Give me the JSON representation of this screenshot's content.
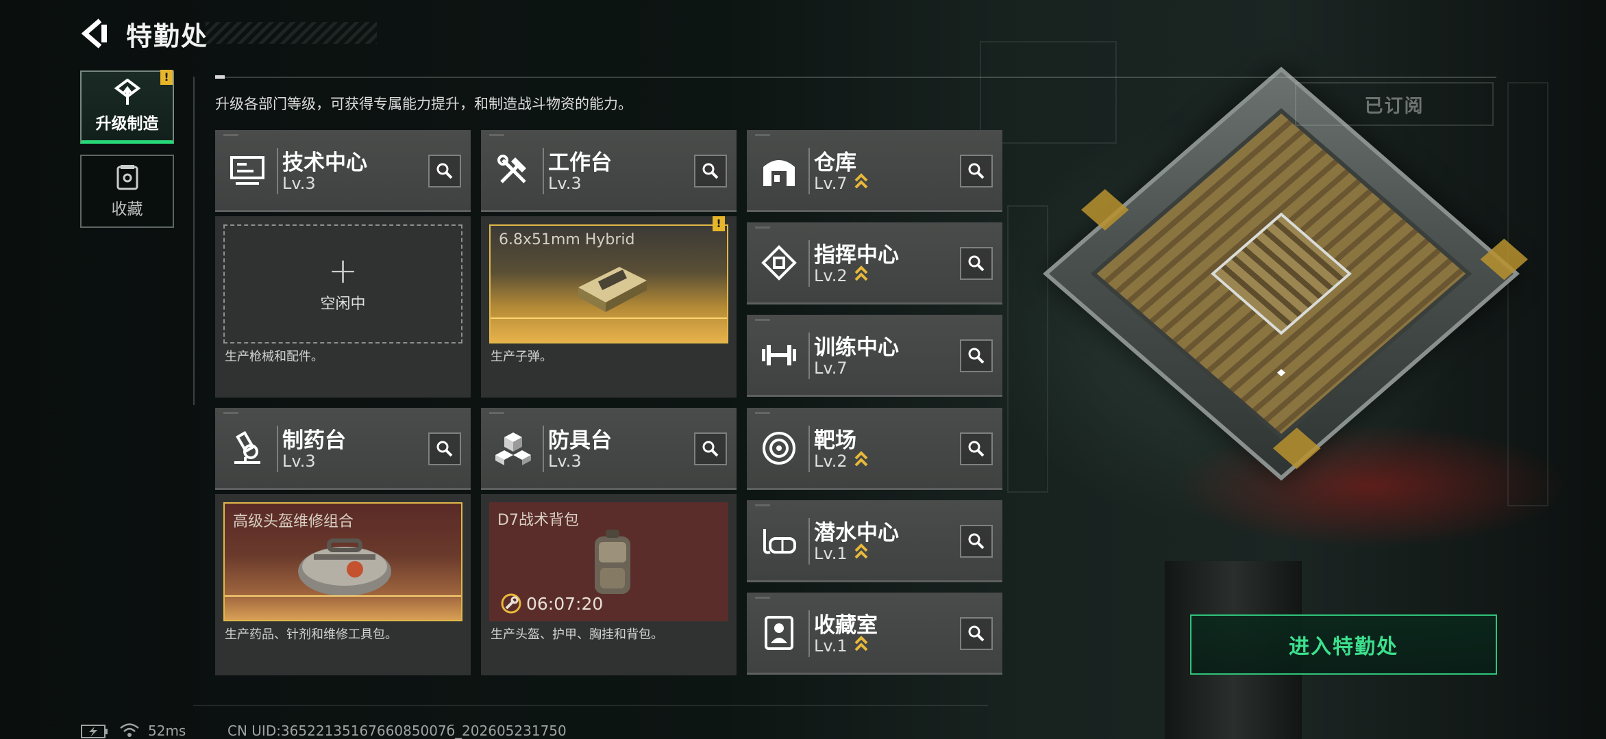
{
  "header": {
    "title": "特勤处"
  },
  "sidebar": {
    "items": [
      {
        "label": "升级制造",
        "active": true,
        "alert": "!"
      },
      {
        "label": "收藏",
        "active": false
      }
    ]
  },
  "subtitle": "升级各部门等级，可获得专属能力提升，和制造战斗物资的能力。",
  "subscribed_label": "已订阅",
  "workshops": [
    {
      "name": "技术中心",
      "level": "Lv.3",
      "icon": "monitor-icon",
      "slot": {
        "state": "idle",
        "plus": "+",
        "label": "空闲中"
      },
      "description": "生产枪械和配件。"
    },
    {
      "name": "工作台",
      "level": "Lv.3",
      "icon": "tools-icon",
      "slot": {
        "state": "producing",
        "item": "6.8x51mm Hybrid",
        "alert": "!"
      },
      "description": "生产子弹。"
    },
    {
      "name": "制药台",
      "level": "Lv.3",
      "icon": "microscope-icon",
      "slot": {
        "state": "producing",
        "item": "高级头盔维修组合"
      },
      "description": "生产药品、针剂和维修工具包。"
    },
    {
      "name": "防具台",
      "level": "Lv.3",
      "icon": "cubes-icon",
      "slot": {
        "state": "producing",
        "item": "D7战术背包",
        "timer": "06:07:20"
      },
      "description": "生产头盔、护甲、胸挂和背包。"
    }
  ],
  "facilities": [
    {
      "name": "仓库",
      "level": "Lv.7",
      "icon": "warehouse-icon",
      "upgradable": true
    },
    {
      "name": "指挥中心",
      "level": "Lv.2",
      "icon": "chip-icon",
      "upgradable": true
    },
    {
      "name": "训练中心",
      "level": "Lv.7",
      "icon": "dumbbell-icon",
      "upgradable": false
    },
    {
      "name": "靶场",
      "level": "Lv.2",
      "icon": "target-icon",
      "upgradable": true
    },
    {
      "name": "潜水中心",
      "level": "Lv.1",
      "icon": "diving-mask-icon",
      "upgradable": true
    },
    {
      "name": "收藏室",
      "level": "Lv.1",
      "icon": "bust-icon",
      "upgradable": true
    }
  ],
  "enter_button": "进入特勤处",
  "status_bar": {
    "ping": "52ms",
    "uid": "CN UID:3652213516766085007б_202605231750"
  },
  "colors": {
    "accent_green": "#3ce08d",
    "alert_yellow": "#e7b52a",
    "upgrade_gold": "#e8b83a"
  }
}
